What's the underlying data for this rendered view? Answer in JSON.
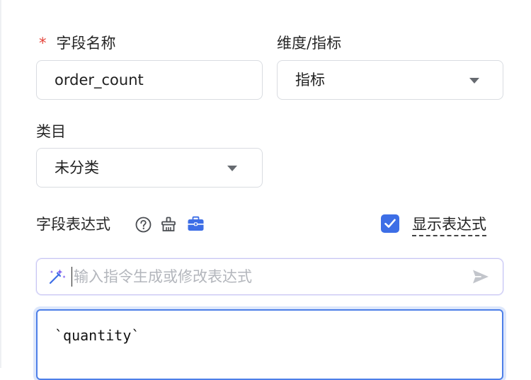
{
  "form": {
    "field_name": {
      "required_mark": "*",
      "label": "字段名称",
      "value": "order_count"
    },
    "dimension_metric": {
      "label": "维度/指标",
      "selected": "指标"
    },
    "category": {
      "label": "类目",
      "selected": "未分类"
    },
    "expression": {
      "label": "字段表达式",
      "icons": [
        "help-icon",
        "broom-icon",
        "toolbox-icon"
      ],
      "show_expression_checkbox": {
        "checked": true,
        "label": "显示表达式"
      },
      "ai_prompt": {
        "placeholder": "输入指令生成或修改表达式",
        "icons": [
          "magic-wand-icon",
          "send-icon"
        ]
      },
      "editor_value": "`quantity`"
    }
  },
  "colors": {
    "required": "#e5443a",
    "accent": "#3d6ee6",
    "border": "#d9dce1",
    "placeholder": "#b3b6bc"
  }
}
